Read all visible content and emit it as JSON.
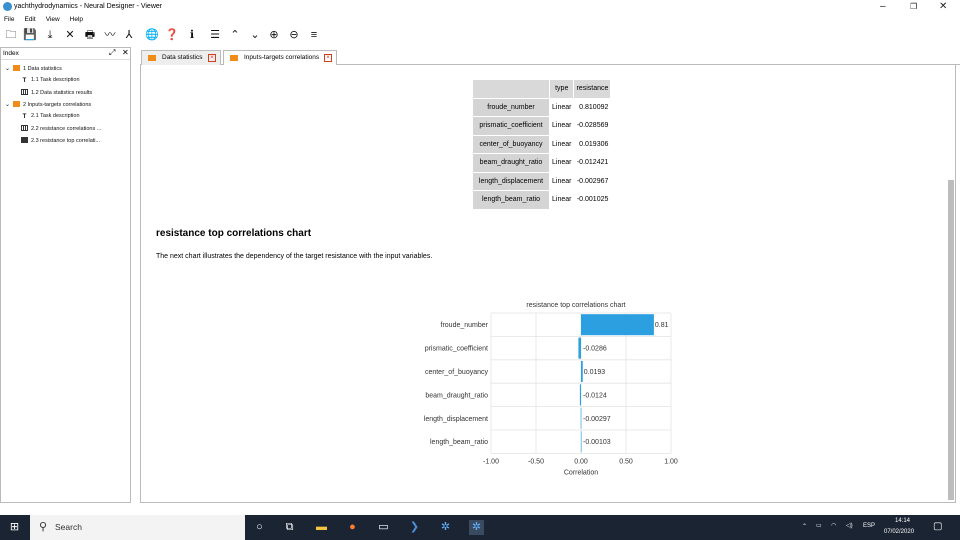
{
  "window": {
    "title": "yachthydrodynamics - Neural Designer - Viewer"
  },
  "menu": [
    "File",
    "Edit",
    "View",
    "Help"
  ],
  "index_panel": {
    "title": "Index",
    "items": [
      {
        "label": "1 Data statistics",
        "icon": "folder-icon",
        "level": 0
      },
      {
        "label": "1.1 Task description",
        "icon": "text-icon",
        "level": 1
      },
      {
        "label": "1.2 Data statistics results",
        "icon": "table-icon",
        "level": 1
      },
      {
        "label": "2 Inputs-targets correlations",
        "icon": "folder-icon",
        "level": 0
      },
      {
        "label": "2.1 Task description",
        "icon": "text-icon",
        "level": 1
      },
      {
        "label": "2.2 resistance correlations ...",
        "icon": "table-icon",
        "level": 1
      },
      {
        "label": "2.3 resistance top correlati...",
        "icon": "chart-icon",
        "level": 1
      }
    ]
  },
  "tabs": [
    {
      "label": "Data statistics",
      "active": false
    },
    {
      "label": "Inputs-targets correlations",
      "active": true
    }
  ],
  "table": {
    "headers": [
      "",
      "type",
      "resistance"
    ],
    "rows": [
      {
        "name": "froude_number",
        "type": "Linear",
        "value": "0.810092"
      },
      {
        "name": "prismatic_coefficient",
        "type": "Linear",
        "value": "-0.028569"
      },
      {
        "name": "center_of_buoyancy",
        "type": "Linear",
        "value": "0.019306"
      },
      {
        "name": "beam_draught_ratio",
        "type": "Linear",
        "value": "-0.012421"
      },
      {
        "name": "length_displacement",
        "type": "Linear",
        "value": "-0.002967"
      },
      {
        "name": "length_beam_ratio",
        "type": "Linear",
        "value": "-0.001025"
      }
    ]
  },
  "section": {
    "title": "resistance top correlations chart",
    "description": "The next chart illustrates the dependency of the target resistance with the input variables."
  },
  "chart_data": {
    "type": "bar",
    "orientation": "horizontal",
    "title": "resistance top correlations chart",
    "xlabel": "Correlation",
    "ylabel": "",
    "xlim": [
      -1.0,
      1.0
    ],
    "xticks": [
      "-1.00",
      "-0.50",
      "0.00",
      "0.50",
      "1.00"
    ],
    "categories": [
      "froude_number",
      "prismatic_coefficient",
      "center_of_buoyancy",
      "beam_draught_ratio",
      "length_displacement",
      "length_beam_ratio"
    ],
    "values": [
      0.81,
      -0.0286,
      0.0193,
      -0.0124,
      -0.00297,
      -0.00103
    ],
    "labels": [
      "0.81",
      "-0.0286",
      "0.0193",
      "-0.0124",
      "-0.00297",
      "-0.00103"
    ],
    "bar_color": "#2b9fe0",
    "grid": true
  },
  "taskbar": {
    "search_placeholder": "Search",
    "language": "ESP",
    "time": "14:14",
    "date": "07/02/2020"
  }
}
